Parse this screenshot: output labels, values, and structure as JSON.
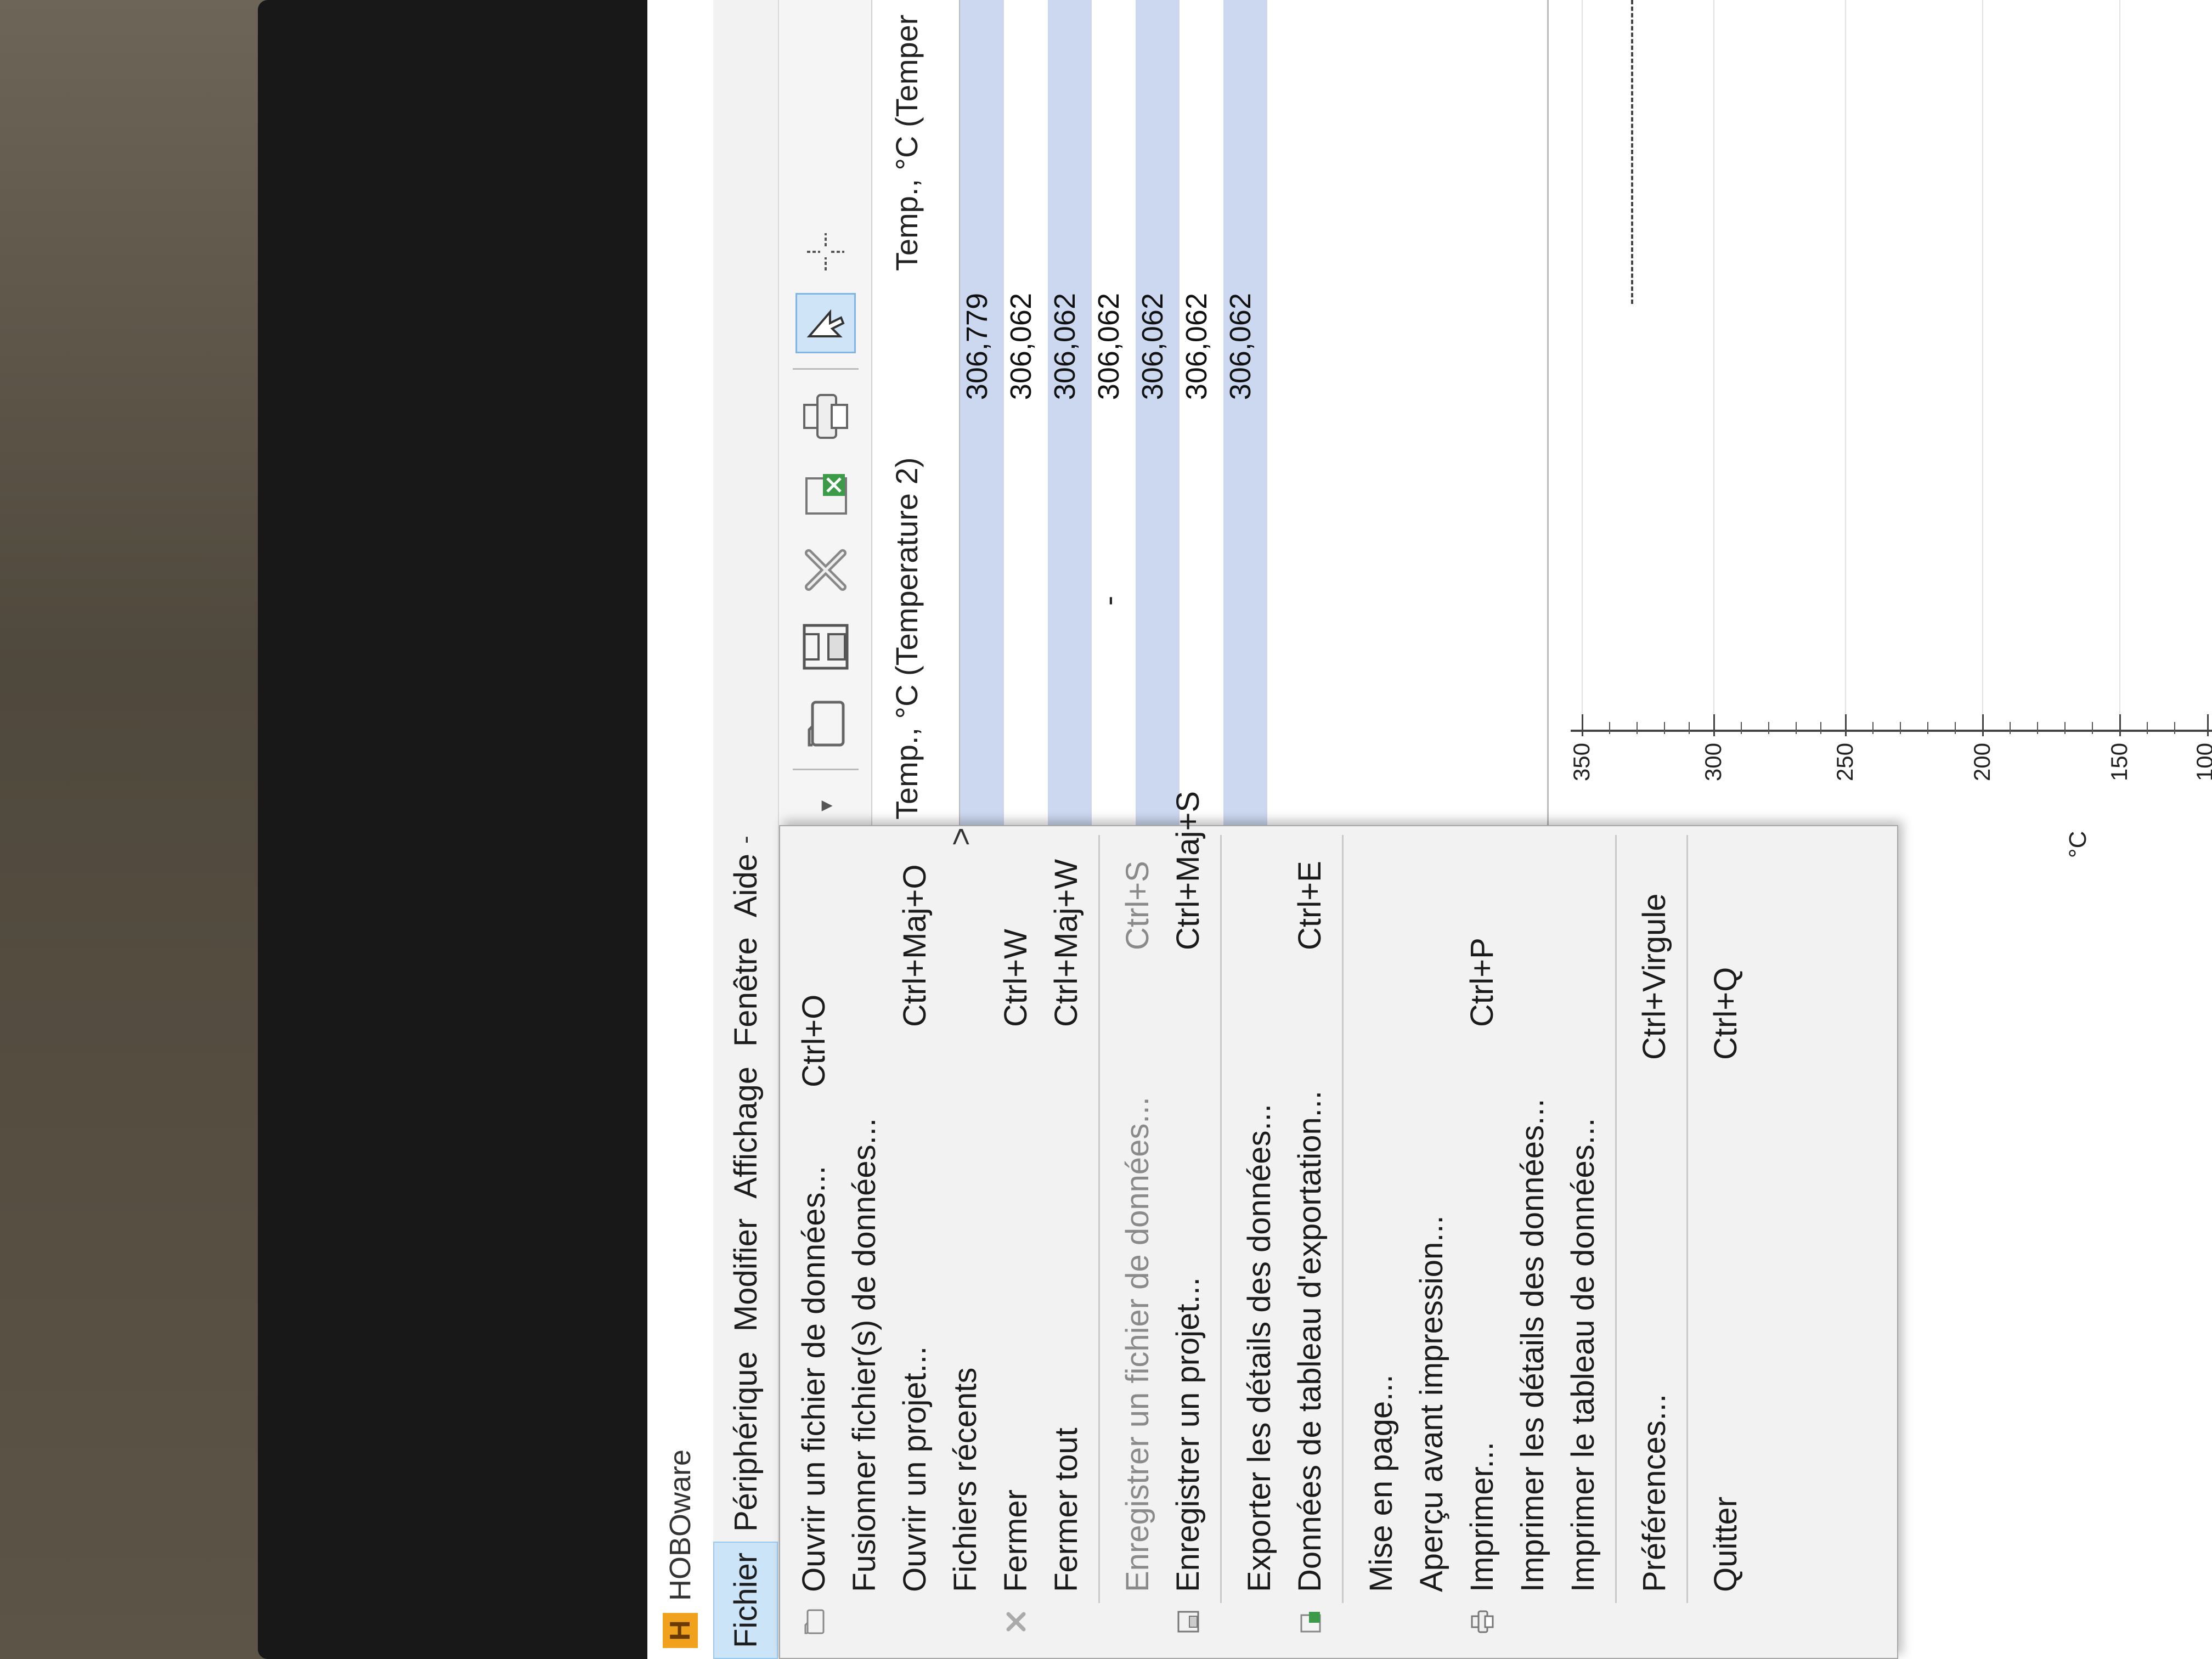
{
  "app": {
    "title": "HOBOware",
    "logo_letter": "H"
  },
  "menubar": {
    "items": [
      "Fichier",
      "Périphérique",
      "Modifier",
      "Affichage",
      "Fenêtre",
      "Aide"
    ],
    "overflow": "-"
  },
  "file_menu": {
    "items": [
      {
        "label": "Ouvrir un fichier de données...",
        "shortcut": "Ctrl+O",
        "icon": "folder-icon"
      },
      {
        "label": "Fusionner fichier(s) de données...",
        "shortcut": "",
        "icon": ""
      },
      {
        "label": "Ouvrir un projet...",
        "shortcut": "Ctrl+Maj+O",
        "icon": ""
      },
      {
        "label": "Fichiers récents",
        "shortcut": "",
        "icon": "",
        "submenu_arrow": ">"
      },
      {
        "label": "Fermer",
        "shortcut": "Ctrl+W",
        "icon": "close-x-icon"
      },
      {
        "label": "Fermer tout",
        "shortcut": "Ctrl+Maj+W",
        "icon": ""
      },
      {
        "label": "Enregistrer un fichier de données...",
        "shortcut": "Ctrl+S",
        "icon": ""
      },
      {
        "label": "Enregistrer un projet...",
        "shortcut": "Ctrl+Maj+S",
        "icon": "save-project-icon"
      },
      {
        "label": "Exporter les détails des données...",
        "shortcut": "",
        "icon": ""
      },
      {
        "label": "Données de tableau d'exportation...",
        "shortcut": "Ctrl+E",
        "icon": "export-table-icon"
      },
      {
        "label": "Mise en page...",
        "shortcut": "",
        "icon": ""
      },
      {
        "label": "Aperçu avant impression...",
        "shortcut": "",
        "icon": ""
      },
      {
        "label": "Imprimer...",
        "shortcut": "Ctrl+P",
        "icon": "printer-icon"
      },
      {
        "label": "Imprimer les détails des données...",
        "shortcut": "",
        "icon": ""
      },
      {
        "label": "Imprimer le tableau de données...",
        "shortcut": "",
        "icon": ""
      },
      {
        "label": "Préférences...",
        "shortcut": "Ctrl+Virgule",
        "icon": ""
      },
      {
        "label": "Quitter",
        "shortcut": "Ctrl+Q",
        "icon": ""
      }
    ]
  },
  "toolbar": {
    "icons": [
      "dropdown-arrow-icon",
      "open-folder-icon",
      "save-icon",
      "close-x-icon",
      "export-excel-icon",
      "print-icon",
      "pointer-tool-icon",
      "crosshair-icon"
    ]
  },
  "table": {
    "headers": [
      "Temp., °C (Temperature 2)",
      "Temp., °C (Temper"
    ],
    "rows": [
      {
        "value": "306,779"
      },
      {
        "value": "306,062"
      },
      {
        "value": "306,062"
      },
      {
        "value": "306,062"
      },
      {
        "value": "306,062"
      },
      {
        "value": "306,062"
      },
      {
        "value": "306,062"
      }
    ],
    "row_marker": "-"
  },
  "chart": {
    "y_ticks": [
      "350",
      "300",
      "250",
      "200",
      "150",
      "100"
    ],
    "unit_label": "°C"
  }
}
